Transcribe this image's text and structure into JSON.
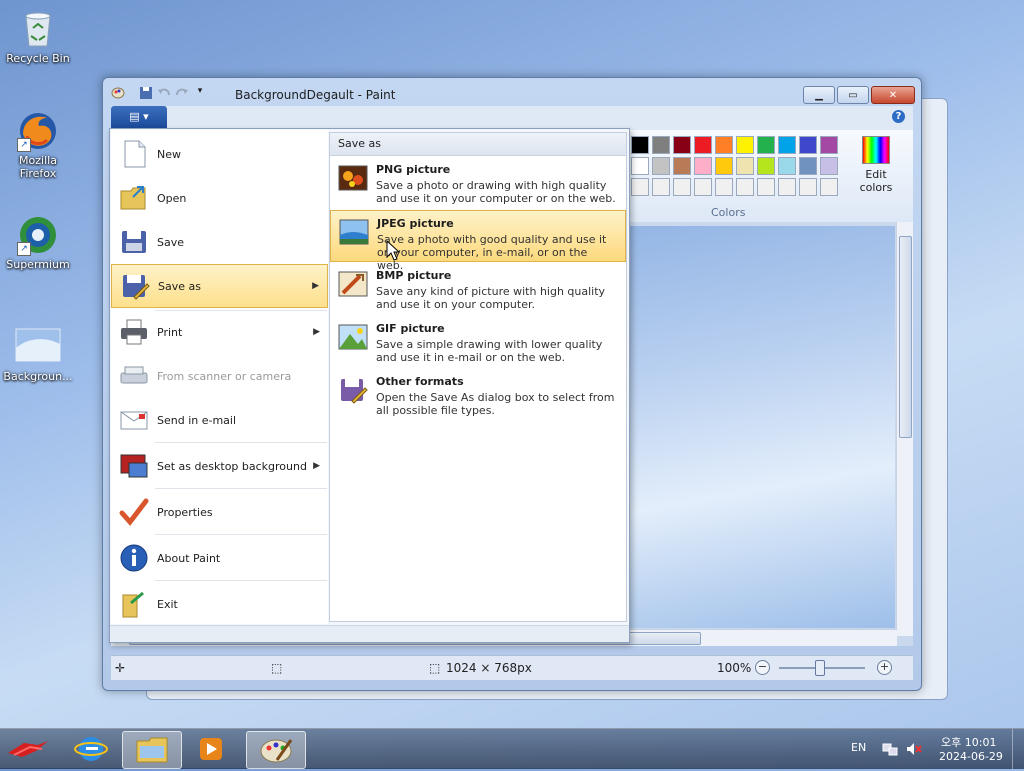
{
  "desktop": {
    "icons": [
      {
        "label": "Recycle Bin",
        "icon": "recycle-bin-icon"
      },
      {
        "label": "Mozilla Firefox",
        "icon": "firefox-icon"
      },
      {
        "label": "Supermium",
        "icon": "supermium-icon"
      },
      {
        "label": "Backgroun...",
        "icon": "image-file-icon"
      }
    ]
  },
  "window": {
    "title": "BackgroundDegault - Paint",
    "help_label": "?",
    "colors_group_label": "Colors",
    "edit_colors_label": "Edit colors",
    "palette_row1": [
      "#000000",
      "#7f7f7f",
      "#880015",
      "#ed1c24",
      "#ff7f27",
      "#fff200",
      "#22b14c",
      "#00a2e8",
      "#3f48cc",
      "#a349a4"
    ],
    "palette_row2": [
      "#ffffff",
      "#c3c3c3",
      "#b97a57",
      "#ffaec9",
      "#ffc90e",
      "#efe4b0",
      "#b5e61d",
      "#99d9ea",
      "#7092be",
      "#c8bfe7"
    ],
    "palette_row3": [
      "#f0f0f0",
      "#f0f0f0",
      "#f0f0f0",
      "#f0f0f0",
      "#f0f0f0",
      "#f0f0f0",
      "#f0f0f0",
      "#f0f0f0",
      "#f0f0f0",
      "#f0f0f0"
    ]
  },
  "status": {
    "image_size": "1024 × 768px",
    "zoom": "100%"
  },
  "menu": {
    "items": [
      {
        "label": "New",
        "icon": "new-file-icon"
      },
      {
        "label": "Open",
        "icon": "open-folder-icon"
      },
      {
        "label": "Save",
        "icon": "save-disk-icon"
      },
      {
        "label": "Save as",
        "icon": "save-as-icon"
      },
      {
        "label": "Print",
        "icon": "printer-icon"
      },
      {
        "label": "From scanner or camera",
        "icon": "scanner-icon"
      },
      {
        "label": "Send in e-mail",
        "icon": "email-icon"
      },
      {
        "label": "Set as desktop background",
        "icon": "desktop-background-icon"
      },
      {
        "label": "Properties",
        "icon": "checkmark-icon"
      },
      {
        "label": "About Paint",
        "icon": "info-icon"
      },
      {
        "label": "Exit",
        "icon": "exit-icon"
      }
    ],
    "submenu_title": "Save as",
    "submenu": [
      {
        "title": "PNG picture",
        "desc": "Save a photo or drawing with high quality and use it on your computer or on the web."
      },
      {
        "title": "JPEG picture",
        "desc": "Save a photo with good quality and use it on your computer, in e-mail, or on the web."
      },
      {
        "title": "BMP picture",
        "desc": "Save any kind of picture with high quality and use it on your computer."
      },
      {
        "title": "GIF picture",
        "desc": "Save a simple drawing with lower quality and use it in e-mail or on the web."
      },
      {
        "title": "Other formats",
        "desc": "Open the Save As dialog box to select from all possible file types."
      }
    ]
  },
  "taskbar": {
    "lang": "EN",
    "time": "오후 10:01",
    "date": "2024-06-29"
  }
}
